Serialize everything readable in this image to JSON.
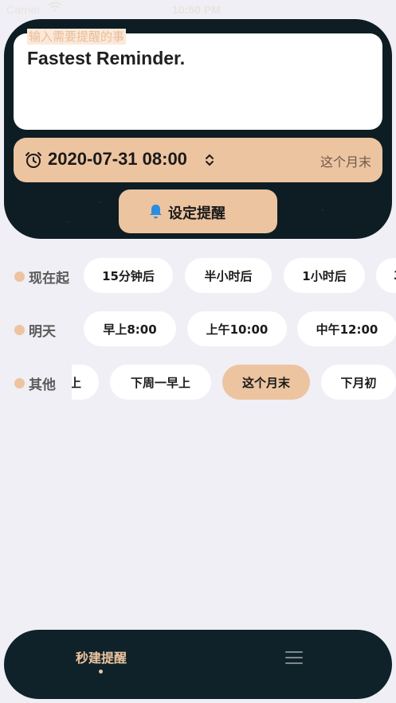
{
  "status_bar": {
    "carrier": "Carrier",
    "time": "10:50 PM"
  },
  "reminder_input": {
    "placeholder": "输入需要提醒的事",
    "value": "Fastest Reminder."
  },
  "time_selector": {
    "datetime": "2020-07-31 08:00",
    "hint": "这个月末"
  },
  "set_button": {
    "label": "设定提醒"
  },
  "quick_rows": [
    {
      "label": "现在起",
      "chips": [
        "15分钟后",
        "半小时后",
        "1小时后",
        "3"
      ]
    },
    {
      "label": "明天",
      "chips": [
        "早上8:00",
        "上午10:00",
        "中午12:00"
      ]
    },
    {
      "label": "其他",
      "chips": [
        "上",
        "下周一早上",
        "这个月末",
        "下月初"
      ],
      "selected": "这个月末"
    }
  ],
  "tab_bar": {
    "tabs": [
      {
        "label": "秒建提醒",
        "active": true
      },
      {
        "icon": "menu-icon"
      }
    ]
  },
  "colors": {
    "accent": "#edc4a0",
    "dark": "#0d1d23",
    "background": "#f0eff5"
  }
}
